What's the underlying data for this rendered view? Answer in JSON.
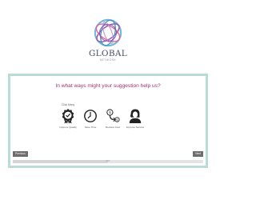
{
  "logo": {
    "name": "GLOBAL",
    "subtitle": "NETWORK"
  },
  "survey": {
    "question": "In what ways might your suggestion help us?",
    "choice_label": "Click Many",
    "options": [
      {
        "label": "Improve Quality",
        "icon": "quality-badge-icon"
      },
      {
        "label": "Save Time",
        "icon": "clock-icon"
      },
      {
        "label": "Reduce Cost",
        "icon": "cost-reduction-icon"
      },
      {
        "label": "Improve Service",
        "icon": "service-person-icon"
      }
    ],
    "previous_label": "Previous",
    "next_label": "Next",
    "progress_text": "50%",
    "progress_value": 0.5
  },
  "colors": {
    "question": "#a0306e",
    "panel_border": "#b9ddd6",
    "button": "#6d6d6d"
  }
}
